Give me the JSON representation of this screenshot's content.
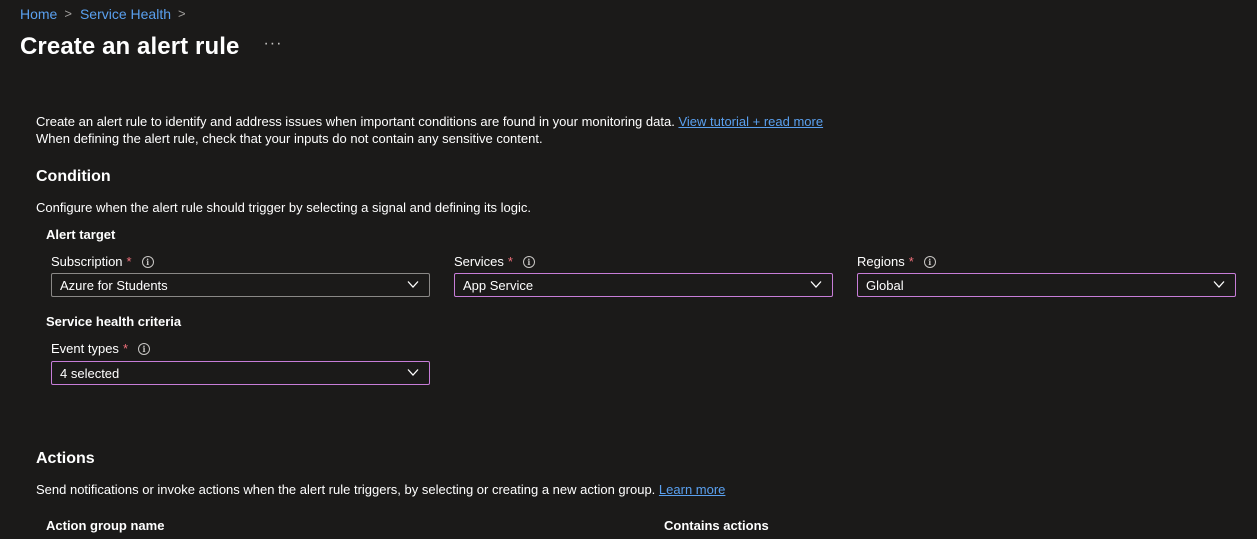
{
  "breadcrumb": {
    "home": "Home",
    "service_health": "Service Health",
    "separator": ">"
  },
  "page": {
    "title": "Create an alert rule",
    "more": "···"
  },
  "intro": {
    "line1": "Create an alert rule to identify and address issues when important conditions are found in your monitoring data.",
    "link": "View tutorial + read more",
    "line2": "When defining the alert rule, check that your inputs do not contain any sensitive content."
  },
  "condition": {
    "title": "Condition",
    "description": "Configure when the alert rule should trigger by selecting a signal and defining its logic.",
    "alert_target": "Alert target",
    "subscription": {
      "label": "Subscription",
      "required": "*",
      "value": "Azure for Students"
    },
    "services": {
      "label": "Services",
      "required": "*",
      "value": "App Service"
    },
    "regions": {
      "label": "Regions",
      "required": "*",
      "value": "Global"
    },
    "service_health_criteria": "Service health criteria",
    "event_types": {
      "label": "Event types",
      "required": "*",
      "value": "4 selected"
    }
  },
  "actions": {
    "title": "Actions",
    "description": "Send notifications or invoke actions when the alert rule triggers, by selecting or creating a new action group.",
    "learn_more": "Learn more",
    "columns": [
      "Action group name",
      "Contains actions"
    ]
  },
  "icons": {
    "info": "info-icon",
    "chevron": "chevron-down-icon"
  },
  "colors": {
    "background": "#1b1a19",
    "link": "#5aa0ef",
    "required": "#f1707b",
    "active_border": "#c77dd8",
    "border": "#8a8886"
  }
}
